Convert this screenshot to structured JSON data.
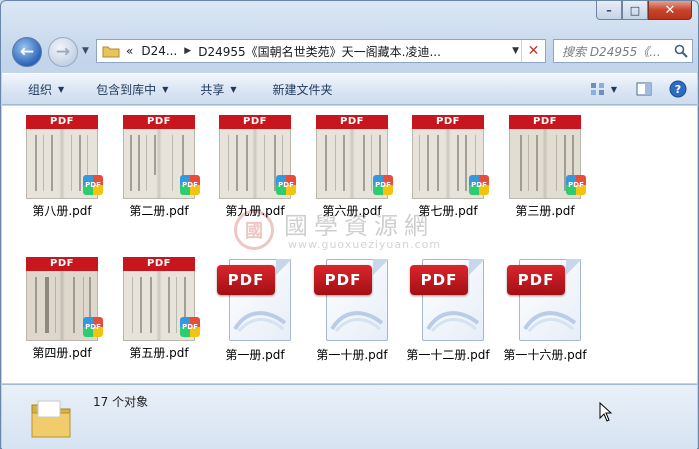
{
  "window": {
    "minimize_label": "–",
    "maximize_label": "□",
    "close_label": "✕"
  },
  "nav": {
    "back_label": "←",
    "forward_label": "→"
  },
  "address": {
    "prefix": "«",
    "segment1": "D24...",
    "segment2": "D24955《国朝名世类苑》天一阁藏本.凌迪...",
    "clear_label": "✕"
  },
  "search": {
    "placeholder": "搜索 D24955《..."
  },
  "toolbar": {
    "organize": "组织",
    "include_library": "包含到库中",
    "share": "共享",
    "new_folder": "新建文件夹"
  },
  "files": [
    {
      "name": "第八册.pdf",
      "kind": "thumb"
    },
    {
      "name": "第二册.pdf",
      "kind": "thumb"
    },
    {
      "name": "第九册.pdf",
      "kind": "thumb"
    },
    {
      "name": "第六册.pdf",
      "kind": "thumb"
    },
    {
      "name": "第七册.pdf",
      "kind": "thumb"
    },
    {
      "name": "第三册.pdf",
      "kind": "thumb"
    },
    {
      "name": "第四册.pdf",
      "kind": "thumb"
    },
    {
      "name": "第五册.pdf",
      "kind": "thumb"
    },
    {
      "name": "第一册.pdf",
      "kind": "generic"
    },
    {
      "name": "第一十册.pdf",
      "kind": "generic"
    },
    {
      "name": "第一十二册.pdf",
      "kind": "generic"
    },
    {
      "name": "第一十六册.pdf",
      "kind": "generic"
    }
  ],
  "pdf_badge": "PDF",
  "watermark": {
    "title": "國學資源網",
    "url": "www.guoxueziyuan.com",
    "logo_char": "國"
  },
  "status": {
    "count_text": "17 个对象"
  },
  "colors": {
    "pdf_red": "#c8161e",
    "window_blue": "#c3d5ea",
    "accent": "#1e395b"
  }
}
